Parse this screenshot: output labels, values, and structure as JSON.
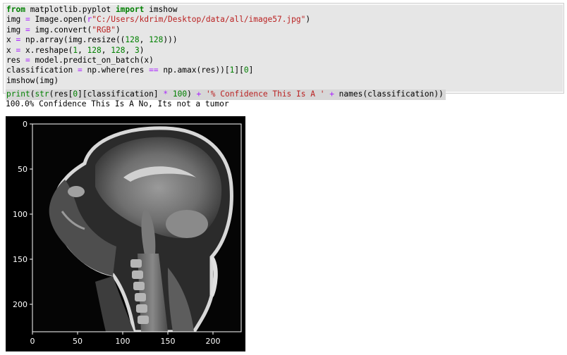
{
  "code_lines": [
    "from matplotlib.pyplot import imshow",
    "img = Image.open(r\"C:/Users/kdrim/Desktop/data/all/image57.jpg\")",
    "img = img.convert(\"RGB\")",
    "x = np.array(img.resize((128, 128)))",
    "x = x.reshape(1, 128, 128, 3)",
    "res = model.predict_on_batch(x)",
    "classification = np.where(res == np.amax(res))[1][0]",
    "imshow(img)",
    "print(str(res[0][classification] * 100) + '% Confidence This Is A ' + names(classification))"
  ],
  "output_text": "100.0% Confidence This Is A No, Its not a tumor",
  "figure": {
    "x_ticks": [
      "0",
      "50",
      "100",
      "150",
      "200"
    ],
    "y_ticks": [
      "0",
      "50",
      "100",
      "150",
      "200"
    ],
    "image_description_icon": "mri-sagittal-head-image"
  },
  "colors": {
    "keyword": "#008000",
    "string": "#ba2121",
    "operator": "#aa22ff",
    "code_bg": "#e6e6e6"
  }
}
